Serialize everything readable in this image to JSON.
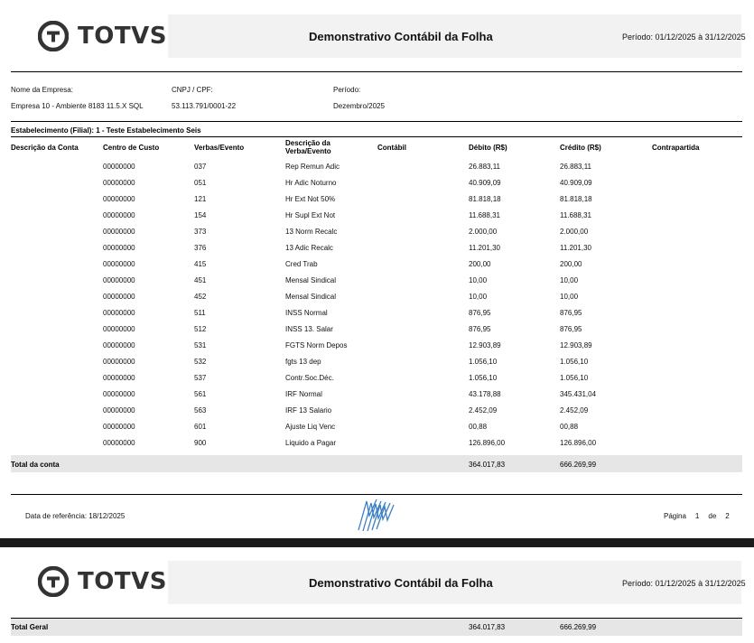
{
  "brand": {
    "name": "TOTVS",
    "icon": "totvs-logo-icon"
  },
  "report": {
    "title": "Demonstrativo Contábil da Folha",
    "periodo_header": "Período: 01/12/2025 à 31/12/2025"
  },
  "info": {
    "empresa_label": "Nome da Empresa:",
    "empresa_value": "Empresa 10 - Ambiente 8183 11.5.X SQL",
    "cnpj_label": "CNPJ / CPF:",
    "cnpj_value": "53.113.791/0001-22",
    "periodo_label": "Período:",
    "periodo_value": "Dezembro/2025"
  },
  "estabelecimento": "Estabelecimento (Filial): 1 - Teste Estabelecimento Seis",
  "columns": {
    "conta": "Descrição da Conta",
    "centro": "Centro de Custo",
    "verbas": "Verbas/Evento",
    "descricao": "Descrição da Verba/Evento",
    "contabil": "Contábil",
    "debito": "Débito (R$)",
    "credito": "Crédito (R$)",
    "contrapartida": "Contrapartida"
  },
  "rows": [
    {
      "centro": "00000000",
      "verba": "037",
      "descricao": "Rep Remun Adic",
      "debito": "26.883,11",
      "credito": "26.883,11"
    },
    {
      "centro": "00000000",
      "verba": "051",
      "descricao": "Hr Adic Noturno",
      "debito": "40.909,09",
      "credito": "40.909,09"
    },
    {
      "centro": "00000000",
      "verba": "121",
      "descricao": "Hr Ext Not  50%",
      "debito": "81.818,18",
      "credito": "81.818,18"
    },
    {
      "centro": "00000000",
      "verba": "154",
      "descricao": "Hr Supl Ext Not",
      "debito": "11.688,31",
      "credito": "11.688,31"
    },
    {
      "centro": "00000000",
      "verba": "373",
      "descricao": "13 Norm Recalc",
      "debito": "2.000,00",
      "credito": "2.000,00"
    },
    {
      "centro": "00000000",
      "verba": "376",
      "descricao": "13 Adic Recalc",
      "debito": "11.201,30",
      "credito": "11.201,30"
    },
    {
      "centro": "00000000",
      "verba": "415",
      "descricao": "Cred Trab",
      "debito": "200,00",
      "credito": "200,00"
    },
    {
      "centro": "00000000",
      "verba": "451",
      "descricao": "Mensal Sindical",
      "debito": "10,00",
      "credito": "10,00"
    },
    {
      "centro": "00000000",
      "verba": "452",
      "descricao": "Mensal Sindical",
      "debito": "10,00",
      "credito": "10,00"
    },
    {
      "centro": "00000000",
      "verba": "511",
      "descricao": "INSS Normal",
      "debito": "876,95",
      "credito": "876,95"
    },
    {
      "centro": "00000000",
      "verba": "512",
      "descricao": "INSS 13. Salar",
      "debito": "876,95",
      "credito": "876,95"
    },
    {
      "centro": "00000000",
      "verba": "531",
      "descricao": "FGTS Norm Depos",
      "debito": "12.903,89",
      "credito": "12.903,89"
    },
    {
      "centro": "00000000",
      "verba": "532",
      "descricao": "fgts 13 dep",
      "debito": "1.056,10",
      "credito": "1.056,10"
    },
    {
      "centro": "00000000",
      "verba": "537",
      "descricao": "Contr.Soc.Déc.",
      "debito": "1.056,10",
      "credito": "1.056,10"
    },
    {
      "centro": "00000000",
      "verba": "561",
      "descricao": "IRF Normal",
      "debito": "43.178,88",
      "credito": "345.431,04"
    },
    {
      "centro": "00000000",
      "verba": "563",
      "descricao": "IRF 13 Salario",
      "debito": "2.452,09",
      "credito": "2.452,09"
    },
    {
      "centro": "00000000",
      "verba": "601",
      "descricao": "Ajuste Liq Venc",
      "debito": "00,88",
      "credito": "00,88"
    },
    {
      "centro": "00000000",
      "verba": "900",
      "descricao": "Liquido a Pagar",
      "debito": "126.896,00",
      "credito": "126.896,00"
    }
  ],
  "total_conta": {
    "label": "Total da conta",
    "debito": "364.017,83",
    "credito": "666.269,99"
  },
  "footer": {
    "data_ref": "Data de referência:  18/12/2025",
    "pagina_label": "Página",
    "pagina_num": "1",
    "de_label": "de",
    "pagina_total": "2",
    "watermark_icon": "totvs-stripes-icon"
  },
  "page2": {
    "brand": "TOTVS",
    "title": "Demonstrativo Contábil da Folha",
    "periodo_header": "Período: 01/12/2025 à 31/12/2025",
    "total_geral": {
      "label": "Total Geral",
      "debito": "364.017,83",
      "credito": "666.269,99"
    }
  },
  "colors": {
    "title_band": "#f2f2f2",
    "total_band": "#e6e6e6",
    "logo": "#333333",
    "watermark": "#3a7fc4"
  }
}
